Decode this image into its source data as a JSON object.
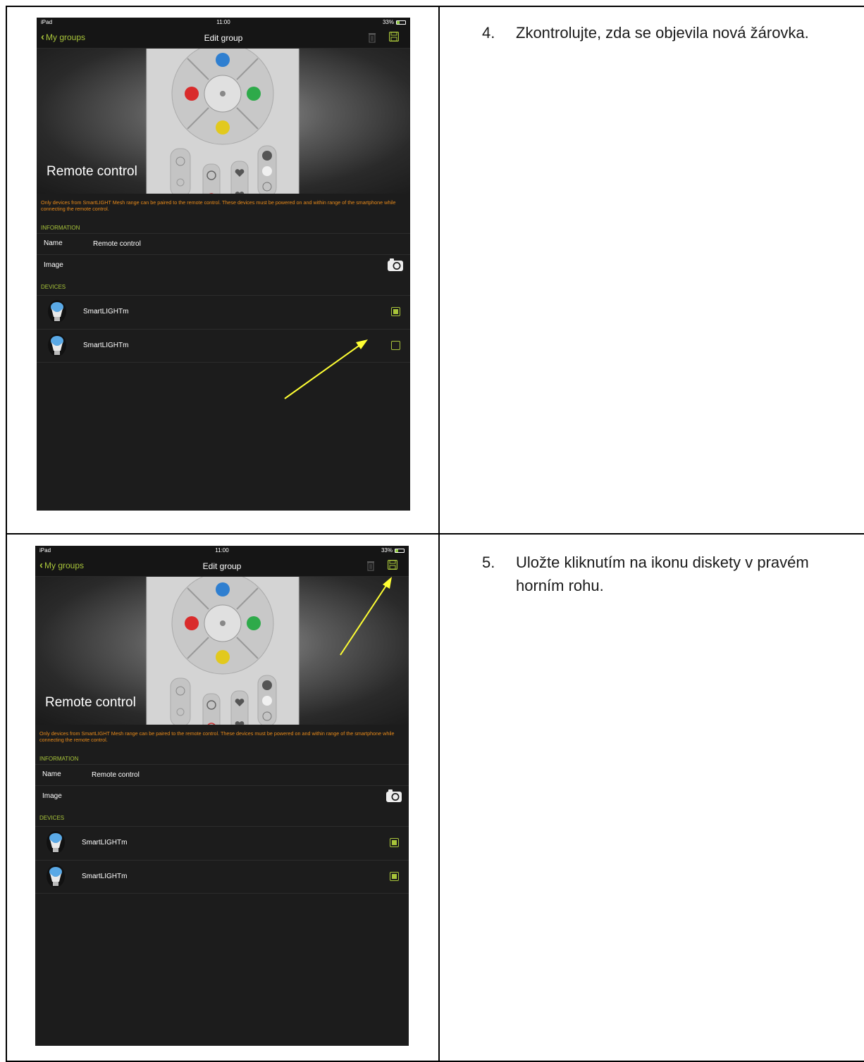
{
  "steps": [
    {
      "number": "4.",
      "text": "Zkontrolujte, zda se objevila nová žárovka."
    },
    {
      "number": "5.",
      "text": "Uložte kliknutím na ikonu diskety v pravém horním rohu."
    }
  ],
  "screens": [
    {
      "status": {
        "carrier": "iPad",
        "time": "11:00",
        "battery": "33%"
      },
      "nav": {
        "back_label": "My groups",
        "title": "Edit group"
      },
      "hero_title": "Remote control",
      "notice": "Only devices from SmartLIGHT Mesh range can be paired to the remote control. These devices must be powered on and within range of the smartphone while connecting the remote control.",
      "information_header": "INFORMATION",
      "name_label": "Name",
      "name_value": "Remote control",
      "image_label": "Image",
      "devices_header": "DEVICES",
      "devices": [
        {
          "name": "SmartLIGHTm",
          "checked": true
        },
        {
          "name": "SmartLIGHTm",
          "checked": false
        }
      ]
    },
    {
      "status": {
        "carrier": "iPad",
        "time": "11:00",
        "battery": "33%"
      },
      "nav": {
        "back_label": "My groups",
        "title": "Edit group"
      },
      "hero_title": "Remote control",
      "notice": "Only devices from SmartLIGHT Mesh range can be paired to the remote control. These devices must be powered on and within range of the smartphone while connecting the remote control.",
      "information_header": "INFORMATION",
      "name_label": "Name",
      "name_value": "Remote control",
      "image_label": "Image",
      "devices_header": "DEVICES",
      "devices": [
        {
          "name": "SmartLIGHTm",
          "checked": true
        },
        {
          "name": "SmartLIGHTm",
          "checked": true
        }
      ]
    }
  ],
  "colors": {
    "accent": "#a8c43a",
    "notice": "#e88a1a",
    "annotation_arrow": "#ffff33",
    "screen_bg": "#1c1c1c"
  }
}
